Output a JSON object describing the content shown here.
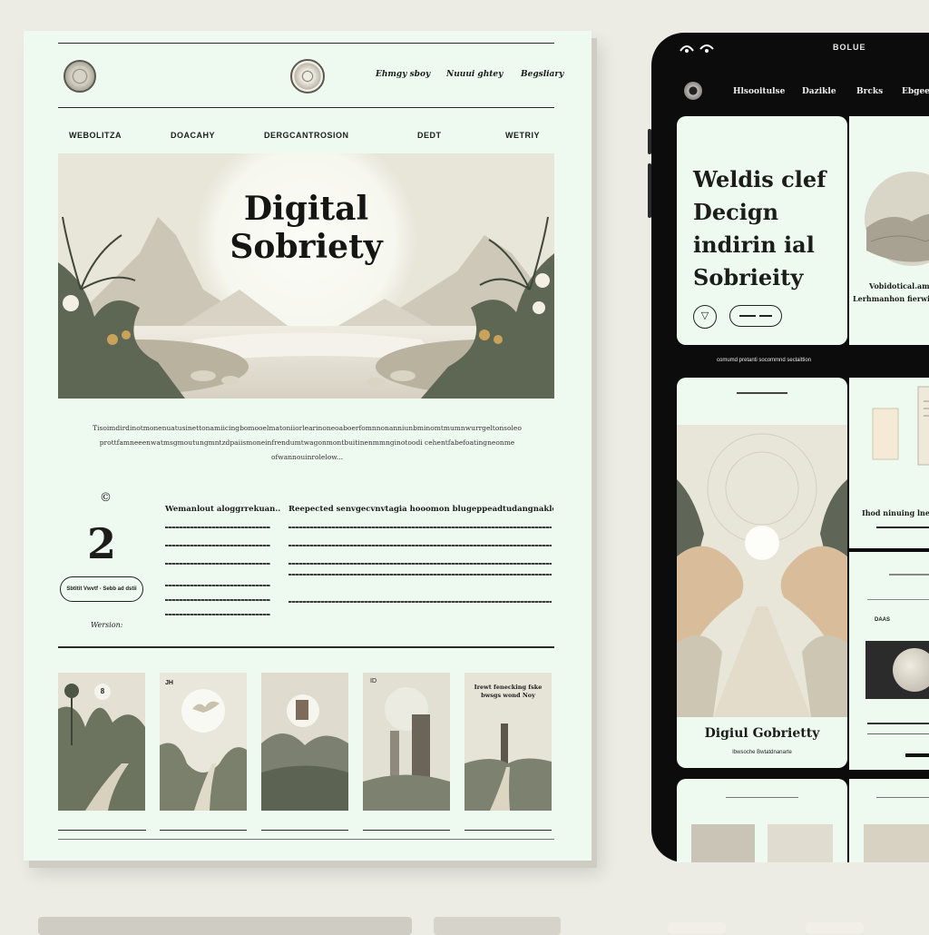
{
  "desktop": {
    "top_links": [
      "Ehmgy sboy",
      "Nuuui ghtey",
      "Begsliary"
    ],
    "nav": [
      "WEBOLITZA",
      "DOACAHY",
      "DERGCANTROSION",
      "DEDT",
      "WETRIY"
    ],
    "hero": {
      "title_line1": "Digital",
      "title_line2": "Sobriety"
    },
    "intro_lines": [
      "Tisoimdirdinotmonenuatusinettonamiicingbomooelmatoniiorlearinoneoaboerfomnnonanniunbminomtmumnwurrgeltonsoleo",
      "prottfamneeenwatmsgmoutungmntzdpaiismoneinfrendumtwagonmontbuitinenmmnginotoodi cehentfabefoatingneonme",
      "ofwannouinrolelow..."
    ],
    "copyright_symbol": "©",
    "counter_number": "2",
    "pill_label": "Sbtitit  Vwvtf - Sebb ad dstii",
    "version_label": "Wersion:",
    "column1_heading": "Wemanlout aloggrrekuan..",
    "column2_heading": "Reepected senvgecvnvtagia hooomon blugeppeadtudangnaklcaleeatli tildo.",
    "thumb_badge": "8",
    "thumb2_badge": "JH",
    "thumb4_badge": "ID",
    "thumb5_caption": "Irewt fenecking fske bwsgs wond Noy"
  },
  "mobile": {
    "status_title": "BOLUE",
    "nav": [
      "Hlsooitulse",
      "Dazikle",
      "Brcks",
      "Ebgee"
    ],
    "card1_title": [
      "Weldis clef",
      "Decign",
      "indirin ial",
      "Sobrieity"
    ],
    "card2_caption_lines": [
      "Vobidotical.am",
      "Lerhmanhon fierwit.Boc"
    ],
    "between_caption": "comumd pretanti socommnd seclaittion",
    "card3_title": "Digiul Gobrietty",
    "card3_subtitle": "Ibwsoche Bwtatdnanarte",
    "side_caption": "Ihod ninuing lnetloo",
    "side_label": "DAAS"
  },
  "colors": {
    "page_bg": "#eefaf0",
    "ink": "#1c1c1a",
    "device": "#0c0c0c",
    "muted_sage": "#a9ad98"
  },
  "icons": [
    "emblem-logo",
    "seal-logo",
    "copyright-icon",
    "wifi-icon",
    "signal-icon",
    "camera-icon",
    "compass-icon",
    "slider-icon"
  ]
}
